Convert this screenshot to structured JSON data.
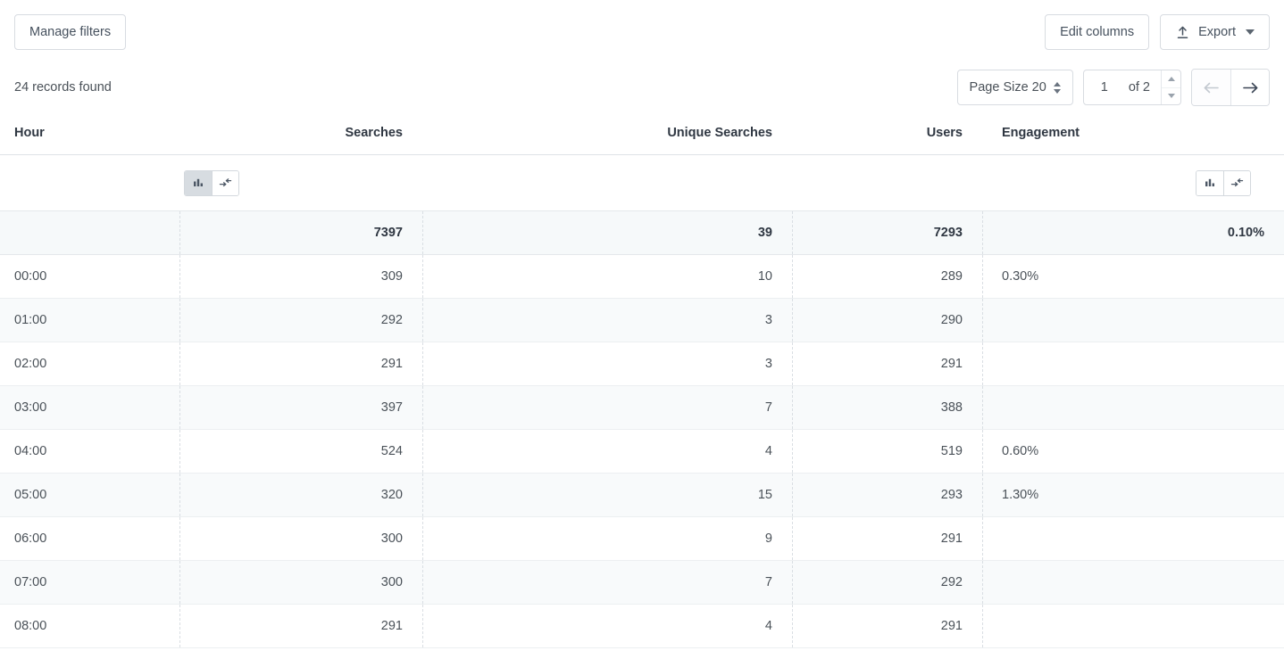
{
  "toolbar": {
    "manage_filters_label": "Manage filters",
    "edit_columns_label": "Edit columns",
    "export_label": "Export"
  },
  "subbar": {
    "records_found": "24 records found",
    "page_size_label": "Page Size 20",
    "page_number": "1",
    "of_pages": "of 2"
  },
  "table": {
    "columns": [
      {
        "key": "hour",
        "label": "Hour",
        "align": "left"
      },
      {
        "key": "searches",
        "label": "Searches",
        "align": "right"
      },
      {
        "key": "unique_searches",
        "label": "Unique Searches",
        "align": "right"
      },
      {
        "key": "users",
        "label": "Users",
        "align": "right"
      },
      {
        "key": "engagement",
        "label": "Engagement",
        "align": "left"
      }
    ],
    "totals": {
      "hour": "",
      "searches": "7397",
      "unique_searches": "39",
      "users": "7293",
      "engagement": "0.10%"
    },
    "rows": [
      {
        "hour": "00:00",
        "searches": "309",
        "unique_searches": "10",
        "users": "289",
        "engagement": "0.30%"
      },
      {
        "hour": "01:00",
        "searches": "292",
        "unique_searches": "3",
        "users": "290",
        "engagement": ""
      },
      {
        "hour": "02:00",
        "searches": "291",
        "unique_searches": "3",
        "users": "291",
        "engagement": ""
      },
      {
        "hour": "03:00",
        "searches": "397",
        "unique_searches": "7",
        "users": "388",
        "engagement": ""
      },
      {
        "hour": "04:00",
        "searches": "524",
        "unique_searches": "4",
        "users": "519",
        "engagement": "0.60%"
      },
      {
        "hour": "05:00",
        "searches": "320",
        "unique_searches": "15",
        "users": "293",
        "engagement": "1.30%"
      },
      {
        "hour": "06:00",
        "searches": "300",
        "unique_searches": "9",
        "users": "291",
        "engagement": ""
      },
      {
        "hour": "07:00",
        "searches": "300",
        "unique_searches": "7",
        "users": "292",
        "engagement": ""
      },
      {
        "hour": "08:00",
        "searches": "291",
        "unique_searches": "4",
        "users": "291",
        "engagement": ""
      }
    ]
  },
  "column_tools": {
    "searches_group": {
      "chart_active": true,
      "collapse_active": false
    },
    "engagement_group": {
      "chart_active": false,
      "collapse_active": false
    }
  },
  "icons": {
    "export": "upload-icon",
    "caret": "chevron-down-icon",
    "page_size_stepper": "updown-chevrons-icon",
    "prev_page": "arrow-left-icon",
    "next_page": "arrow-right-icon",
    "bar_chart": "bar-chart-icon",
    "collapse": "collapse-arrows-icon"
  },
  "colors": {
    "border": "#d8dce1",
    "text": "#4a5158",
    "header_text": "#2f3742",
    "totals_bg": "#f6f9fa",
    "stripe_bg": "#f8fafb",
    "toggle_active_bg": "#d7dce1",
    "disabled_icon": "#c3c9d0"
  }
}
